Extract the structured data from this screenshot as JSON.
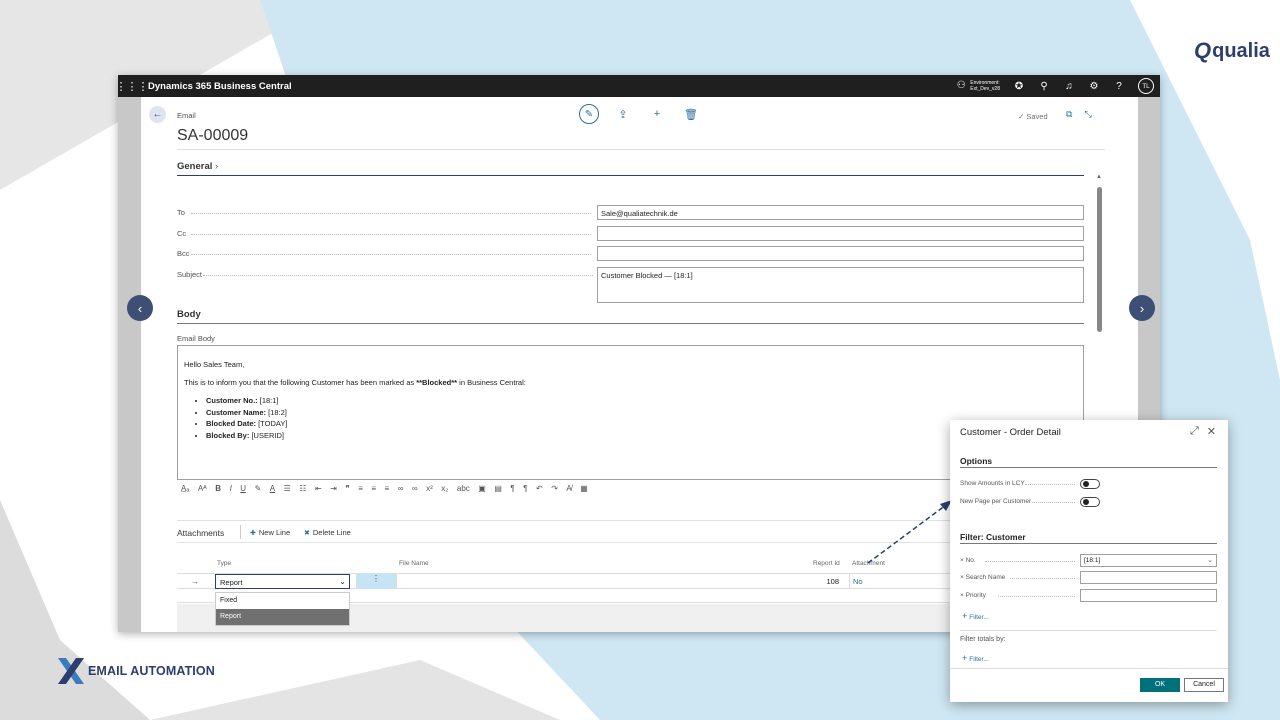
{
  "branding": {
    "top_logo": "qualia",
    "bottom_label": "EMAIL AUTOMATION"
  },
  "topbar": {
    "app_title": "Dynamics 365 Business Central",
    "env_line1": "Environment:",
    "env_line2": "Ext_Dev_v28",
    "avatar": "TL"
  },
  "header": {
    "breadcrumb": "Email",
    "title": "SA-00009",
    "saved": "Saved"
  },
  "general": {
    "section_title": "General",
    "fields": [
      {
        "label": "To",
        "value": "Sale@qualiatechnik.de"
      },
      {
        "label": "Cc",
        "value": ""
      },
      {
        "label": "Bcc",
        "value": ""
      },
      {
        "label": "Subject",
        "value": "Customer Blocked — [18:1]"
      }
    ]
  },
  "body": {
    "section_title": "Body",
    "field_label": "Email Body",
    "greeting": "Hello Sales Team,",
    "intro_pre": "This is to inform you that the following Customer has been marked as ",
    "intro_bold": "**Blocked**",
    "intro_post": " in Business Central:",
    "items": [
      {
        "key": "Customer No.:",
        "value": " [18:1]"
      },
      {
        "key": "Customer Name:",
        "value": " [18:2]"
      },
      {
        "key": "Blocked Date:",
        "value": " [TODAY]"
      },
      {
        "key": "Blocked By:",
        "value": " [USERID]"
      }
    ]
  },
  "attachments": {
    "title": "Attachments",
    "new_line": "New Line",
    "delete_line": "Delete Line",
    "columns": {
      "type": "Type",
      "file_name": "File Name",
      "report_id": "Report Id",
      "attachment": "Attachment"
    },
    "row": {
      "type": "Report",
      "report_id": "108",
      "attachment": "No"
    },
    "type_options": [
      "Fixed",
      "Report"
    ],
    "selected_option": "Report"
  },
  "dialog": {
    "title": "Customer - Order Detail",
    "options_title": "Options",
    "options": [
      {
        "label": "Show Amounts in LCY",
        "on": false
      },
      {
        "label": "New Page per Customer",
        "on": false
      }
    ],
    "filter_title": "Filter: Customer",
    "filters": [
      {
        "label": "No.",
        "value": "[18:1]"
      },
      {
        "label": "Search Name",
        "value": ""
      },
      {
        "label": "Priority",
        "value": ""
      }
    ],
    "add_filter": "Filter...",
    "totals_label": "Filter totals by:",
    "add_totals_filter": "Filter...",
    "ok": "OK",
    "cancel": "Cancel"
  },
  "colors": {
    "brand_navy": "#2c3e6e",
    "ok_button": "#00707a",
    "selected_cell": "#c6e4f3"
  }
}
